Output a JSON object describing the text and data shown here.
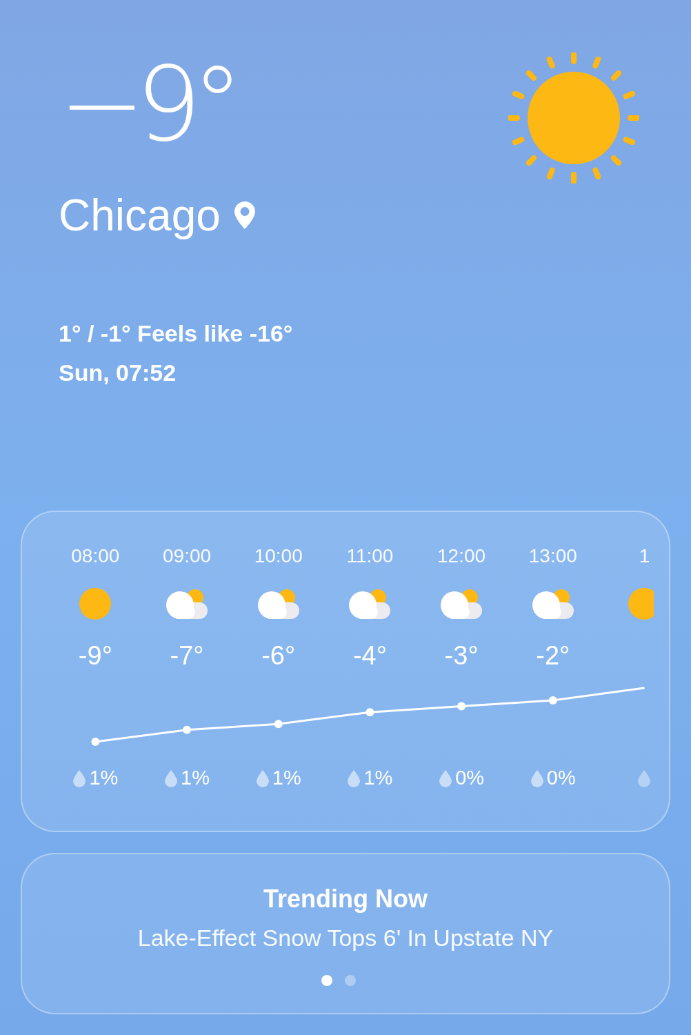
{
  "current": {
    "temperature": "−9°",
    "city": "Chicago",
    "high_low_feels": "1° / -1° Feels like -16°",
    "date_time": "Sun, 07:52"
  },
  "hourly": [
    {
      "time": "08:00",
      "kind": "sun",
      "temp": "-9°",
      "precip": "1%"
    },
    {
      "time": "09:00",
      "kind": "cloudy",
      "temp": "-7°",
      "precip": "1%"
    },
    {
      "time": "10:00",
      "kind": "cloudy",
      "temp": "-6°",
      "precip": "1%"
    },
    {
      "time": "11:00",
      "kind": "cloudy",
      "temp": "-4°",
      "precip": "1%"
    },
    {
      "time": "12:00",
      "kind": "cloudy",
      "temp": "-3°",
      "precip": "0%"
    },
    {
      "time": "13:00",
      "kind": "cloudy",
      "temp": "-2°",
      "precip": "0%"
    },
    {
      "time": "1",
      "kind": "sun"
    }
  ],
  "trending": {
    "title": "Trending Now",
    "headline": "Lake-Effect Snow Tops 6' In Upstate NY"
  },
  "pages": [
    {
      "selected": true
    },
    {
      "selected": false
    }
  ]
}
